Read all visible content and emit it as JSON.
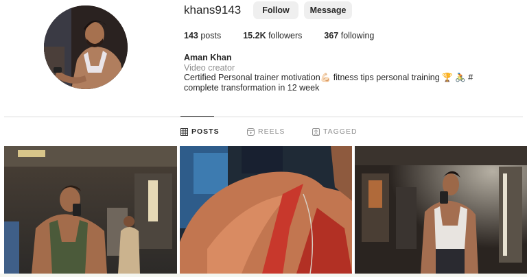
{
  "profile": {
    "username": "khans9143",
    "follow_label": "Follow",
    "message_label": "Message",
    "posts_count": "143",
    "posts_label": "posts",
    "followers_count": "15.2K",
    "followers_label": "followers",
    "following_count": "367",
    "following_label": "following",
    "full_name": "Aman Khan",
    "category": "Video creator",
    "bio": "Certified Personal trainer motivation💪🏻 fitness tips personal training 🏆 🚴 # complete transformation in 12 week"
  },
  "tabs": [
    {
      "label": "POSTS",
      "icon": "grid-icon",
      "active": true
    },
    {
      "label": "REELS",
      "icon": "reels-icon",
      "active": false
    },
    {
      "label": "TAGGED",
      "icon": "tagged-icon",
      "active": false
    }
  ],
  "posts": [
    {
      "subject": "gym-mirror-selfie-green-tank"
    },
    {
      "subject": "shoulder-closeup-red-tank"
    },
    {
      "subject": "gym-mirror-selfie-white-tank"
    }
  ],
  "colors": {
    "button_bg": "#efefef",
    "text": "#262626",
    "muted": "#8e8e8e",
    "divider": "#dbdbdb"
  }
}
